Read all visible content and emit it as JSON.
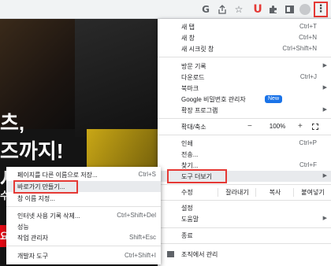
{
  "toolbar": {
    "icons": [
      "google-g-icon",
      "share-icon",
      "star-icon",
      "extension-u-icon",
      "puzzle-icon",
      "side-panel-icon",
      "profile-icon",
      "kebab-menu-icon"
    ],
    "g_letter": "G",
    "u_letter": "U",
    "menu_glyph": "⋮"
  },
  "page": {
    "hero_line1": "츠,",
    "hero_line2": "즈까지!",
    "hero_line3": "세",
    "hero_line4": "수",
    "cta": "요!"
  },
  "menu": {
    "new_tab": {
      "label": "새 탭",
      "shortcut": "Ctrl+T"
    },
    "new_window": {
      "label": "새 창",
      "shortcut": "Ctrl+N"
    },
    "new_incognito": {
      "label": "새 시크릿 창",
      "shortcut": "Ctrl+Shift+N"
    },
    "history": {
      "label": "방문 기록"
    },
    "downloads": {
      "label": "다운로드",
      "shortcut": "Ctrl+J"
    },
    "bookmarks": {
      "label": "북마크"
    },
    "password_manager": {
      "label": "Google 비밀번호 관리자",
      "badge": "New"
    },
    "extensions": {
      "label": "확장 프로그램"
    },
    "zoom": {
      "label": "확대/축소",
      "minus": "−",
      "value": "100%",
      "plus": "+"
    },
    "print": {
      "label": "인쇄",
      "shortcut": "Ctrl+P"
    },
    "cast": {
      "label": "전송..."
    },
    "find": {
      "label": "찾기...",
      "shortcut": "Ctrl+F"
    },
    "more_tools": {
      "label": "도구 더보기"
    },
    "edit": {
      "label": "수정",
      "cut": "잘라내기",
      "copy": "복사",
      "paste": "붙여넣기"
    },
    "settings": {
      "label": "설정"
    },
    "help": {
      "label": "도움말"
    },
    "exit": {
      "label": "종료"
    },
    "managed": {
      "label": "조직에서 관리"
    }
  },
  "submenu": {
    "save_page": {
      "label": "페이지를 다른 이름으로 저장...",
      "shortcut": "Ctrl+S"
    },
    "create_shortcut": {
      "label": "바로가기 만들기..."
    },
    "name_window": {
      "label": "창 이름 지정..."
    },
    "clear_data": {
      "label": "인터넷 사용 기록 삭제...",
      "shortcut": "Ctrl+Shift+Del"
    },
    "performance": {
      "label": "성능"
    },
    "task_manager": {
      "label": "작업 관리자",
      "shortcut": "Shift+Esc"
    },
    "dev_tools": {
      "label": "개발자 도구",
      "shortcut": "Ctrl+Shift+I"
    }
  },
  "colors": {
    "highlight_border": "#e53935",
    "badge": "#1a73e8",
    "netflix_red": "#e50914"
  }
}
